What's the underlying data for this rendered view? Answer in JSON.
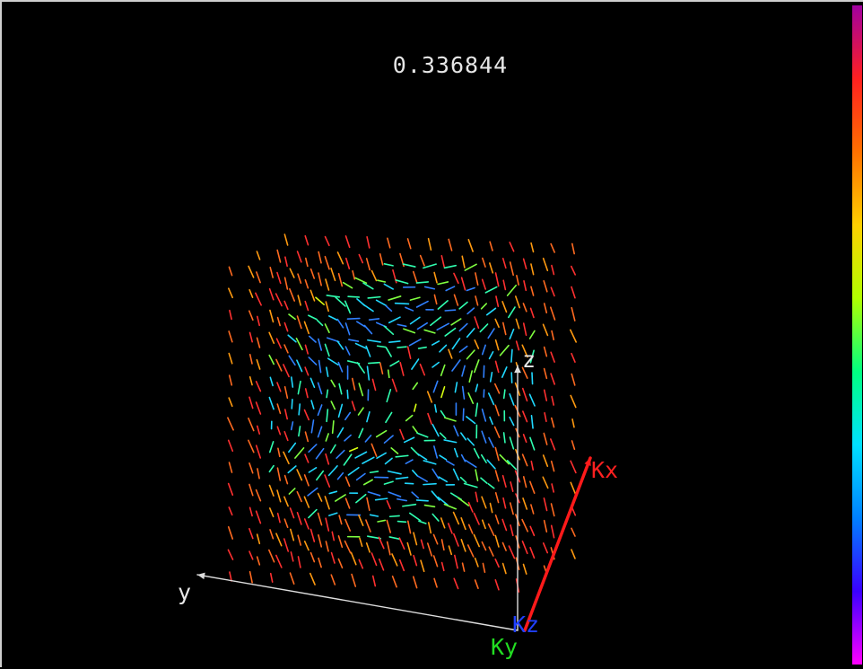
{
  "viewer": {
    "time_value": "0.336844",
    "axes": {
      "z_label": "z",
      "y_label": "y",
      "kx_label": "Kx",
      "ky_label": "Ky",
      "kz_label": "Kz"
    },
    "colors": {
      "background": "#000000",
      "kx_axis": "#ff1a1a",
      "ky_axis": "#22dd22",
      "kz_axis": "#2040ff",
      "axis_lines": "#dddddd",
      "colormap": [
        "#ff00ff",
        "#3a00ff",
        "#0080ff",
        "#00e0ff",
        "#00ff80",
        "#b0ff00",
        "#ffd000",
        "#ff7000",
        "#ff2020",
        "#a000a0"
      ]
    },
    "colorbar": {
      "visible": true,
      "orientation": "vertical"
    },
    "vector_field": {
      "grid": "3D lattice",
      "glyph": "line"
    }
  }
}
